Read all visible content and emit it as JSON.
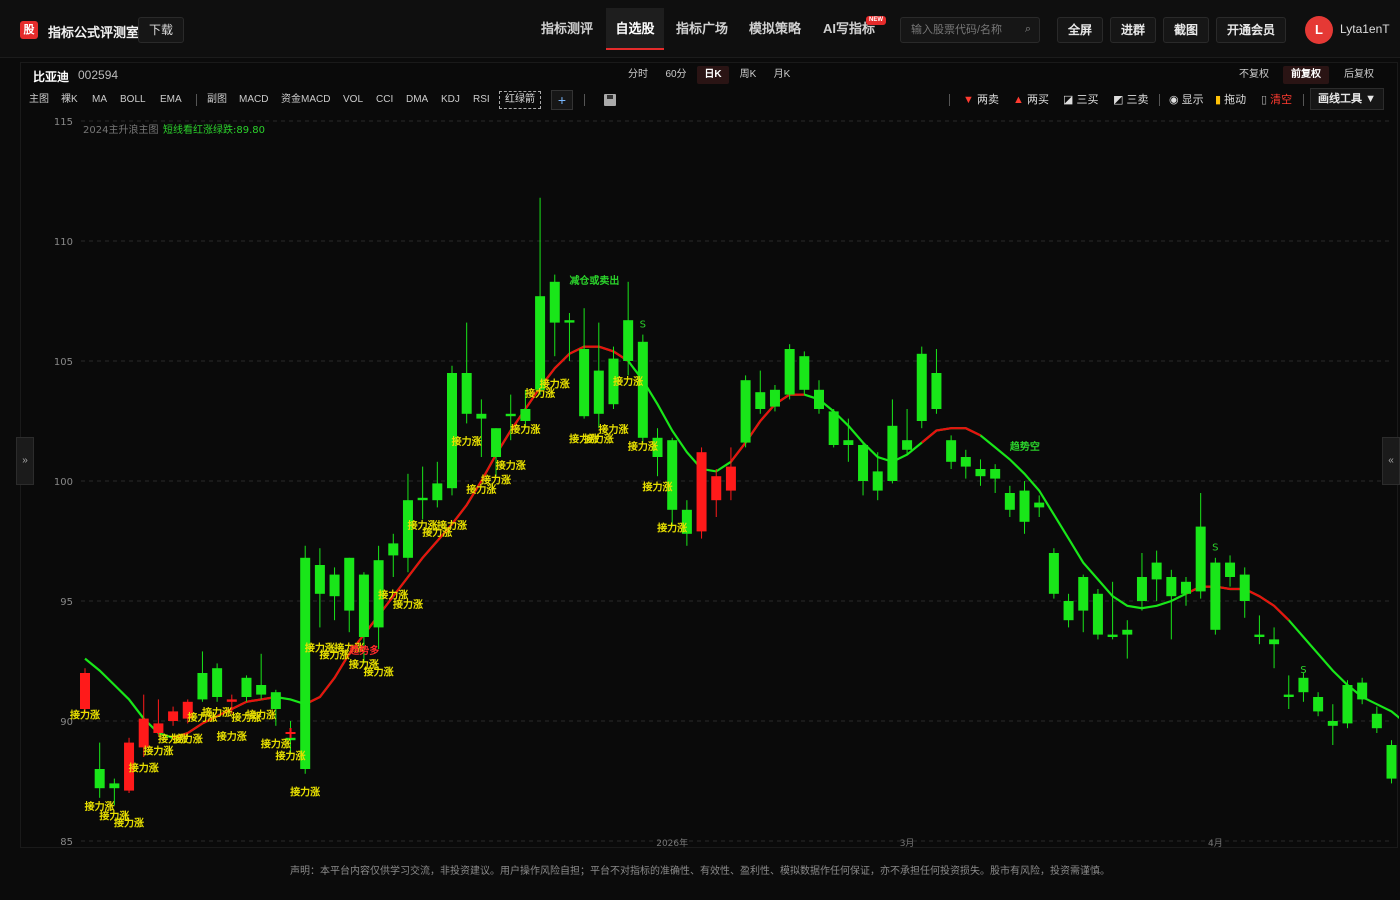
{
  "header": {
    "logo_text": "股",
    "app_title": "指标公式评测室",
    "download_label": "下载",
    "nav": [
      {
        "label": "指标测评",
        "active": false
      },
      {
        "label": "自选股",
        "active": true
      },
      {
        "label": "指标广场",
        "active": false
      },
      {
        "label": "模拟策略",
        "active": false
      },
      {
        "label": "AI写指标",
        "active": false
      }
    ],
    "new_badge": "NEW",
    "search_placeholder": "输入股票代码/名称",
    "buttons": [
      "全屏",
      "进群",
      "截图",
      "开通会员"
    ],
    "avatar_letter": "L",
    "username": "Lyta1enT"
  },
  "stock": {
    "name": "比亚迪",
    "code": "002594"
  },
  "periods": [
    {
      "label": "分时",
      "active": false
    },
    {
      "label": "60分",
      "active": false
    },
    {
      "label": "日K",
      "active": true
    },
    {
      "label": "周K",
      "active": false
    },
    {
      "label": "月K",
      "active": false
    }
  ],
  "adjust": [
    {
      "label": "不复权",
      "active": false
    },
    {
      "label": "前复权",
      "active": true
    },
    {
      "label": "后复权",
      "active": false
    }
  ],
  "indicators": {
    "main_label": "主图",
    "main": [
      "裸K",
      "MA",
      "BOLL",
      "EMA"
    ],
    "sub_label": "副图",
    "sub": [
      "MACD",
      "资金MACD",
      "VOL",
      "CCI",
      "DMA",
      "KDJ",
      "RSI"
    ],
    "highlight": "红绿箭",
    "add": "+"
  },
  "tools": [
    {
      "label": "两卖",
      "icon": "down-triangle-icon",
      "color": "#ff3b30"
    },
    {
      "label": "两买",
      "icon": "up-triangle-icon",
      "color": "#ff3b30"
    },
    {
      "label": "三买",
      "icon": "line-draw-icon",
      "color": "#ffffff"
    },
    {
      "label": "三卖",
      "icon": "line-draw-icon",
      "color": "#ffffff"
    },
    {
      "label": "显示",
      "icon": "eye-icon",
      "color": "#ffffff"
    },
    {
      "label": "拖动",
      "icon": "lock-icon",
      "color": "#ffc107"
    },
    {
      "label": "清空",
      "icon": "trash-icon",
      "color": "#ff3b30"
    }
  ],
  "draw_tools_label": "画线工具 ▼",
  "footer": "声明：本平台内容仅供学习交流，非投资建议。用户操作风险自担；平台不对指标的准确性、有效性、盈利性、模拟数据作任何保证，亦不承担任何投资损失。股市有风险，投资需谨慎。",
  "chart_data": {
    "type": "candlestick",
    "legend_main": "2024主升浪主图",
    "legend_signal": "短线看红涨绿跌:89.80",
    "y_ticks": [
      85,
      90,
      95,
      100,
      105,
      110,
      115
    ],
    "ylim": [
      85,
      115
    ],
    "x_month_labels": [
      {
        "i": 40,
        "label": "2026年"
      },
      {
        "i": 56,
        "label": "3月"
      },
      {
        "i": 77,
        "label": "4月"
      }
    ],
    "colors": {
      "up": "#ff1a1a",
      "down": "#19e619",
      "signal": "#e8e000",
      "text_green": "#2bd12b"
    },
    "candles": [
      {
        "o": 90.5,
        "c": 92.0,
        "h": 92.2,
        "l": 90.3
      },
      {
        "o": 88.0,
        "c": 87.2,
        "h": 89.1,
        "l": 86.8
      },
      {
        "o": 87.4,
        "c": 87.2,
        "h": 87.6,
        "l": 86.5
      },
      {
        "o": 87.1,
        "c": 89.1,
        "h": 89.3,
        "l": 87.0
      },
      {
        "o": 88.9,
        "c": 90.1,
        "h": 91.1,
        "l": 88.5
      },
      {
        "o": 89.5,
        "c": 89.9,
        "h": 90.9,
        "l": 89.4
      },
      {
        "o": 90.0,
        "c": 90.4,
        "h": 90.6,
        "l": 89.8
      },
      {
        "o": 90.1,
        "c": 90.8,
        "h": 90.9,
        "l": 89.9
      },
      {
        "o": 92.0,
        "c": 90.9,
        "h": 92.9,
        "l": 90.8
      },
      {
        "o": 92.2,
        "c": 91.0,
        "h": 92.4,
        "l": 90.8
      },
      {
        "o": 90.8,
        "c": 90.9,
        "h": 91.1,
        "l": 90.3
      },
      {
        "o": 91.8,
        "c": 91.0,
        "h": 91.9,
        "l": 90.8
      },
      {
        "o": 91.5,
        "c": 91.1,
        "h": 92.8,
        "l": 90.9
      },
      {
        "o": 91.2,
        "c": 90.5,
        "h": 91.3,
        "l": 89.8
      },
      {
        "o": 89.3,
        "c": 89.2,
        "h": 90.0,
        "l": 88.6
      },
      {
        "o": 96.8,
        "c": 88.0,
        "h": 97.3,
        "l": 87.8
      },
      {
        "o": 96.5,
        "c": 95.3,
        "h": 97.2,
        "l": 93.9
      },
      {
        "o": 96.1,
        "c": 95.2,
        "h": 96.4,
        "l": 94.2
      },
      {
        "o": 96.8,
        "c": 94.6,
        "h": 96.8,
        "l": 93.7
      },
      {
        "o": 96.1,
        "c": 93.5,
        "h": 96.2,
        "l": 92.4
      },
      {
        "o": 96.7,
        "c": 93.9,
        "h": 97.3,
        "l": 93.0
      },
      {
        "o": 97.4,
        "c": 96.9,
        "h": 97.8,
        "l": 96.0
      },
      {
        "o": 99.2,
        "c": 96.8,
        "h": 100.3,
        "l": 96.2
      },
      {
        "o": 99.3,
        "c": 99.2,
        "h": 100.6,
        "l": 98.4
      },
      {
        "o": 99.9,
        "c": 99.2,
        "h": 100.8,
        "l": 98.9
      },
      {
        "o": 104.5,
        "c": 99.7,
        "h": 104.8,
        "l": 99.4
      },
      {
        "o": 104.5,
        "c": 102.8,
        "h": 106.6,
        "l": 102.4
      },
      {
        "o": 102.8,
        "c": 102.6,
        "h": 103.4,
        "l": 101.0
      },
      {
        "o": 102.2,
        "c": 101.0,
        "h": 102.2,
        "l": 100.2
      },
      {
        "o": 102.8,
        "c": 102.7,
        "h": 103.6,
        "l": 101.7
      },
      {
        "o": 103.0,
        "c": 102.5,
        "h": 103.8,
        "l": 102.2
      },
      {
        "o": 107.7,
        "c": 103.8,
        "h": 111.8,
        "l": 103.6
      },
      {
        "o": 108.3,
        "c": 106.6,
        "h": 108.6,
        "l": 105.2
      },
      {
        "o": 106.7,
        "c": 106.6,
        "h": 107.0,
        "l": 105.0
      },
      {
        "o": 105.5,
        "c": 102.7,
        "h": 107.2,
        "l": 102.6
      },
      {
        "o": 104.6,
        "c": 102.8,
        "h": 106.6,
        "l": 102.2
      },
      {
        "o": 105.1,
        "c": 103.2,
        "h": 105.6,
        "l": 103.0
      },
      {
        "o": 106.7,
        "c": 105.0,
        "h": 108.3,
        "l": 104.4
      },
      {
        "o": 105.8,
        "c": 101.8,
        "h": 106.1,
        "l": 101.6
      },
      {
        "o": 101.8,
        "c": 101.0,
        "h": 102.2,
        "l": 100.2
      },
      {
        "o": 101.7,
        "c": 98.8,
        "h": 101.8,
        "l": 98.1
      },
      {
        "o": 98.8,
        "c": 97.8,
        "h": 99.2,
        "l": 97.3
      },
      {
        "o": 97.9,
        "c": 101.2,
        "h": 101.4,
        "l": 97.6
      },
      {
        "o": 99.2,
        "c": 100.2,
        "h": 100.5,
        "l": 98.5
      },
      {
        "o": 99.6,
        "c": 100.6,
        "h": 101.4,
        "l": 99.2
      },
      {
        "o": 104.2,
        "c": 101.6,
        "h": 104.4,
        "l": 101.4
      },
      {
        "o": 103.7,
        "c": 103.0,
        "h": 104.6,
        "l": 102.8
      },
      {
        "o": 103.8,
        "c": 103.1,
        "h": 104.0,
        "l": 102.9
      },
      {
        "o": 105.5,
        "c": 103.6,
        "h": 105.7,
        "l": 103.4
      },
      {
        "o": 105.2,
        "c": 103.8,
        "h": 105.4,
        "l": 103.6
      },
      {
        "o": 103.8,
        "c": 103.0,
        "h": 104.2,
        "l": 102.8
      },
      {
        "o": 102.9,
        "c": 101.5,
        "h": 103.0,
        "l": 101.4
      },
      {
        "o": 101.7,
        "c": 101.5,
        "h": 102.6,
        "l": 100.8
      },
      {
        "o": 101.5,
        "c": 100.0,
        "h": 101.6,
        "l": 99.4
      },
      {
        "o": 100.4,
        "c": 99.6,
        "h": 101.2,
        "l": 99.2
      },
      {
        "o": 102.3,
        "c": 100.0,
        "h": 103.4,
        "l": 99.9
      },
      {
        "o": 101.7,
        "c": 101.3,
        "h": 103.0,
        "l": 101.1
      },
      {
        "o": 105.3,
        "c": 102.5,
        "h": 105.6,
        "l": 102.2
      },
      {
        "o": 104.5,
        "c": 103.0,
        "h": 105.5,
        "l": 102.8
      },
      {
        "o": 101.7,
        "c": 100.8,
        "h": 101.9,
        "l": 100.5
      },
      {
        "o": 101.0,
        "c": 100.6,
        "h": 101.3,
        "l": 100.1
      },
      {
        "o": 100.5,
        "c": 100.2,
        "h": 100.9,
        "l": 99.8
      },
      {
        "o": 100.5,
        "c": 100.1,
        "h": 100.7,
        "l": 99.5
      },
      {
        "o": 99.5,
        "c": 98.8,
        "h": 99.8,
        "l": 98.5
      },
      {
        "o": 99.6,
        "c": 98.3,
        "h": 100.0,
        "l": 97.8
      },
      {
        "o": 99.1,
        "c": 98.9,
        "h": 99.4,
        "l": 98.5
      },
      {
        "o": 97.0,
        "c": 95.3,
        "h": 97.2,
        "l": 95.1
      },
      {
        "o": 95.0,
        "c": 94.2,
        "h": 95.3,
        "l": 93.9
      },
      {
        "o": 96.0,
        "c": 94.6,
        "h": 96.1,
        "l": 93.7
      },
      {
        "o": 95.3,
        "c": 93.6,
        "h": 95.5,
        "l": 93.4
      },
      {
        "o": 93.6,
        "c": 93.5,
        "h": 95.8,
        "l": 93.4
      },
      {
        "o": 93.8,
        "c": 93.6,
        "h": 94.2,
        "l": 92.6
      },
      {
        "o": 96.0,
        "c": 95.0,
        "h": 97.0,
        "l": 94.6
      },
      {
        "o": 96.6,
        "c": 95.9,
        "h": 97.1,
        "l": 95.0
      },
      {
        "o": 96.0,
        "c": 95.2,
        "h": 96.3,
        "l": 93.4
      },
      {
        "o": 95.8,
        "c": 95.3,
        "h": 96.0,
        "l": 94.8
      },
      {
        "o": 98.1,
        "c": 95.4,
        "h": 99.5,
        "l": 95.1
      },
      {
        "o": 96.6,
        "c": 93.8,
        "h": 96.8,
        "l": 93.6
      },
      {
        "o": 96.6,
        "c": 96.0,
        "h": 96.9,
        "l": 95.6
      },
      {
        "o": 96.1,
        "c": 95.0,
        "h": 96.4,
        "l": 94.3
      },
      {
        "o": 93.6,
        "c": 93.5,
        "h": 94.4,
        "l": 93.2
      },
      {
        "o": 93.4,
        "c": 93.2,
        "h": 93.9,
        "l": 92.2
      },
      {
        "o": 91.1,
        "c": 91.0,
        "h": 91.9,
        "l": 90.5
      },
      {
        "o": 91.8,
        "c": 91.2,
        "h": 92.0,
        "l": 90.8
      },
      {
        "o": 91.0,
        "c": 90.4,
        "h": 91.2,
        "l": 90.2
      },
      {
        "o": 90.0,
        "c": 89.8,
        "h": 90.7,
        "l": 89.0
      },
      {
        "o": 91.5,
        "c": 89.9,
        "h": 91.7,
        "l": 89.7
      },
      {
        "o": 91.6,
        "c": 90.9,
        "h": 91.8,
        "l": 90.7
      },
      {
        "o": 90.3,
        "c": 89.7,
        "h": 90.6,
        "l": 89.5
      },
      {
        "o": 89.0,
        "c": 87.6,
        "h": 89.2,
        "l": 87.4
      },
      {
        "o": 87.1,
        "c": 86.9,
        "h": 87.7,
        "l": 86.1
      }
    ],
    "ma": [
      92.6,
      92.1,
      91.5,
      90.9,
      90.1,
      89.5,
      89.3,
      89.5,
      89.9,
      90.2,
      90.5,
      90.8,
      90.9,
      91.0,
      90.9,
      90.7,
      91.0,
      91.8,
      92.8,
      93.6,
      94.4,
      95.2,
      96.0,
      96.8,
      97.5,
      98.2,
      99.0,
      100.0,
      101.1,
      102.1,
      103.0,
      103.9,
      104.7,
      105.3,
      105.6,
      105.6,
      105.4,
      105.0,
      104.2,
      103.2,
      102.1,
      101.2,
      100.5,
      100.4,
      100.8,
      101.6,
      102.5,
      103.2,
      103.6,
      103.6,
      103.4,
      102.9,
      102.3,
      101.6,
      101.0,
      100.8,
      101.1,
      101.6,
      102.1,
      102.2,
      102.2,
      101.9,
      101.4,
      100.9,
      100.3,
      99.6,
      98.6,
      97.6,
      96.6,
      95.9,
      95.2,
      94.8,
      94.7,
      94.8,
      95.0,
      95.3,
      95.6,
      95.6,
      95.5,
      95.5,
      95.2,
      94.8,
      94.2,
      93.5,
      92.8,
      92.1,
      91.5,
      91.0,
      90.7,
      90.4,
      89.9
    ],
    "ma_red_ranges": [
      [
        6,
        13
      ],
      [
        15,
        37
      ],
      [
        44,
        49
      ],
      [
        57,
        61
      ],
      [
        75,
        82
      ]
    ],
    "signals": [
      {
        "i": 0,
        "label": "接力涨",
        "y": 90.1
      },
      {
        "i": 1,
        "label": "接力涨",
        "y": 86.3
      },
      {
        "i": 2,
        "label": "接力涨",
        "y": 85.9
      },
      {
        "i": 3,
        "label": "接力涨",
        "y": 85.6
      },
      {
        "i": 4,
        "label": "接力涨",
        "y": 87.9
      },
      {
        "i": 5,
        "label": "接力涨",
        "y": 88.6
      },
      {
        "i": 6,
        "label": "接力涨",
        "y": 89.1
      },
      {
        "i": 7,
        "label": "接力涨",
        "y": 89.1
      },
      {
        "i": 8,
        "label": "接力涨",
        "y": 90.0
      },
      {
        "i": 9,
        "label": "接力涨",
        "y": 90.2
      },
      {
        "i": 10,
        "label": "接力涨",
        "y": 89.2
      },
      {
        "i": 11,
        "label": "接力涨",
        "y": 90.0
      },
      {
        "i": 12,
        "label": "接力涨",
        "y": 90.1
      },
      {
        "i": 13,
        "label": "接力涨",
        "y": 88.9
      },
      {
        "i": 14,
        "label": "接力涨",
        "y": 88.4
      },
      {
        "i": 15,
        "label": "接力涨",
        "y": 86.9
      },
      {
        "i": 16,
        "label": "接力涨",
        "y": 92.9
      },
      {
        "i": 17,
        "label": "接力涨",
        "y": 92.6
      },
      {
        "i": 18,
        "label": "接力涨",
        "y": 92.9
      },
      {
        "i": 19,
        "label": "接力涨",
        "y": 92.2
      },
      {
        "i": 20,
        "label": "接力涨",
        "y": 91.9
      },
      {
        "i": 21,
        "label": "接力涨",
        "y": 95.1
      },
      {
        "i": 22,
        "label": "接力涨",
        "y": 94.7
      },
      {
        "i": 23,
        "label": "接力涨",
        "y": 98.0
      },
      {
        "i": 24,
        "label": "接力涨",
        "y": 97.7
      },
      {
        "i": 25,
        "label": "接力涨",
        "y": 98.0
      },
      {
        "i": 26,
        "label": "接力涨",
        "y": 101.5
      },
      {
        "i": 27,
        "label": "接力涨",
        "y": 99.5
      },
      {
        "i": 28,
        "label": "接力涨",
        "y": 99.9
      },
      {
        "i": 29,
        "label": "接力涨",
        "y": 100.5
      },
      {
        "i": 30,
        "label": "接力涨",
        "y": 102.0
      },
      {
        "i": 31,
        "label": "接力涨",
        "y": 103.5
      },
      {
        "i": 32,
        "label": "接力涨",
        "y": 103.9
      },
      {
        "i": 34,
        "label": "接力涨",
        "y": 101.6
      },
      {
        "i": 35,
        "label": "接力涨",
        "y": 101.6
      },
      {
        "i": 36,
        "label": "接力涨",
        "y": 102.0
      },
      {
        "i": 37,
        "label": "接力涨",
        "y": 104.0
      },
      {
        "i": 38,
        "label": "接力涨",
        "y": 101.3
      },
      {
        "i": 39,
        "label": "接力涨",
        "y": 99.6
      },
      {
        "i": 40,
        "label": "接力涨",
        "y": 97.9
      }
    ],
    "annotations": [
      {
        "i": 18,
        "y": 92.8,
        "text": "趋势多",
        "color": "#ff2a2a"
      },
      {
        "i": 33,
        "y": 108.2,
        "text": "减仓或卖出",
        "color": "#2bd12b"
      },
      {
        "i": 63,
        "y": 101.3,
        "text": "趋势空",
        "color": "#2bd12b"
      }
    ],
    "s_marks": [
      {
        "i": 38,
        "y": 106.4
      },
      {
        "i": 77,
        "y": 97.1
      },
      {
        "i": 83,
        "y": 92.0
      }
    ],
    "cross_marks": [
      {
        "i": 14,
        "y": 89.5
      }
    ]
  }
}
